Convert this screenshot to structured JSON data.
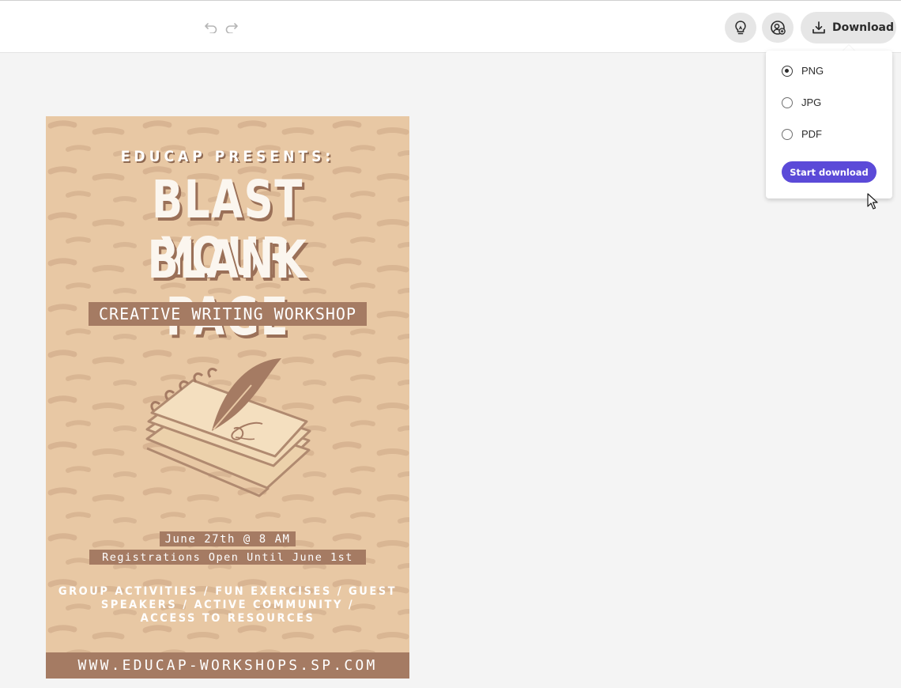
{
  "toolbar": {
    "undo_icon": "undo-arrow-icon",
    "redo_icon": "redo-arrow-icon",
    "ideas_icon": "lightbulb-icon",
    "share_icon": "user-add-icon",
    "download_icon": "download-tray-icon",
    "download_label": "Download"
  },
  "download_menu": {
    "options": [
      {
        "label": "PNG",
        "selected": true
      },
      {
        "label": "JPG",
        "selected": false
      },
      {
        "label": "PDF",
        "selected": false
      }
    ],
    "start_label": "Start download",
    "accent_color": "#5b4ad8"
  },
  "poster": {
    "presents": "EDUCAP PRESENTS:",
    "headline_1": "BLAST YOUR",
    "headline_2": "BLANK PAGE",
    "subtitle": "CREATIVE WRITING WORKSHOP",
    "date": "June 27th @ 8 AM",
    "registration": "Registrations Open Until June 1st",
    "activities_1": "GROUP ACTIVITIES / FUN EXERCISES / GUEST",
    "activities_2": "SPEAKERS / ACTIVE COMMUNITY /",
    "activities_3": "ACCESS TO RESOURCES",
    "website": "WWW.EDUCAP-WORKSHOPS.SP.COM",
    "background_color": "#e8c8a4",
    "band_color": "#a57b63"
  }
}
